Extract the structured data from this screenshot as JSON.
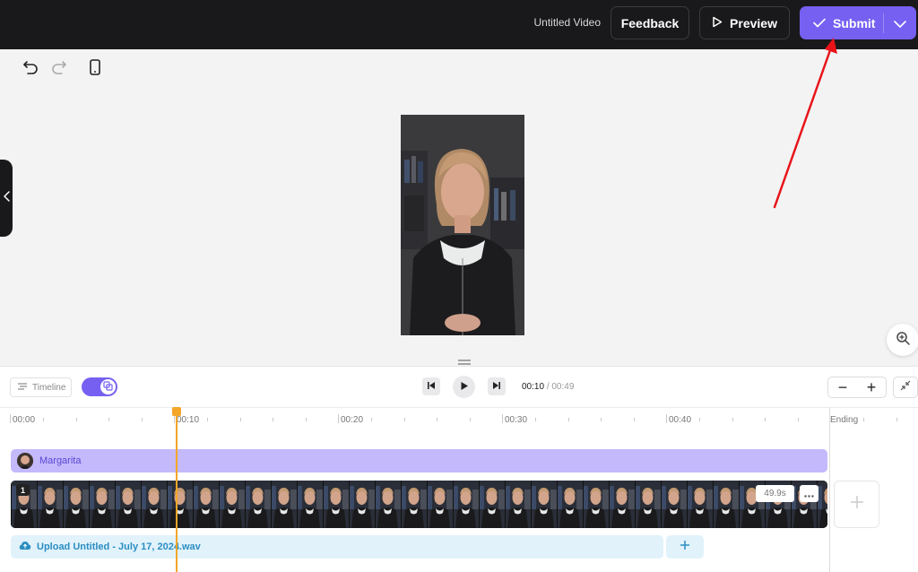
{
  "header": {
    "doc_title": "Untitled Video",
    "feedback_label": "Feedback",
    "preview_label": "Preview",
    "submit_label": "Submit",
    "accent_color": "#7660f1"
  },
  "toolbar": {
    "undo_icon": "undo-icon",
    "redo_icon": "redo-icon",
    "device_icon": "mobile-device-icon"
  },
  "player": {
    "timeline_label": "Timeline",
    "current_time": "00:10",
    "total_time": "/ 00:49",
    "zoom_out_label": "−",
    "zoom_in_label": "+"
  },
  "ruler": {
    "labels": [
      "00:00",
      "00:10",
      "00:20",
      "00:30",
      "00:40"
    ],
    "ending_label": "Ending"
  },
  "tracks": {
    "avatar_name": "Margarita",
    "clip_number": "1",
    "clip_duration": "49.9s",
    "audio_label": "Upload Untitled - July 17, 2024.wav",
    "add_label": "+",
    "playhead_color": "#f4a629"
  }
}
